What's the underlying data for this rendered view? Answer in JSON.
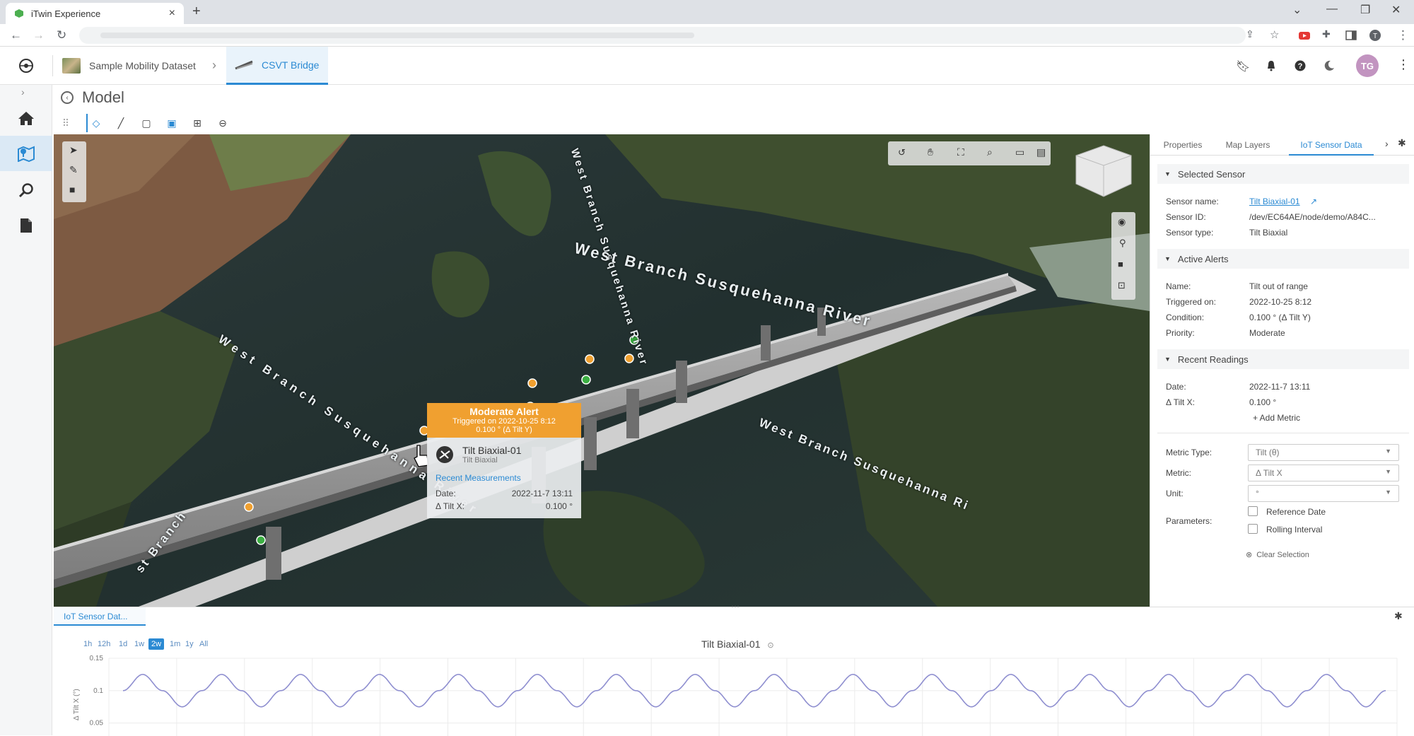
{
  "browser": {
    "tab_title": "iTwin Experience",
    "tab_close": "×",
    "new_tab": "+"
  },
  "header": {
    "breadcrumb_dataset": "Sample Mobility Dataset",
    "breadcrumb_sep": "›",
    "breadcrumb_model": "CSVT Bridge",
    "avatar_initials": "TG"
  },
  "page": {
    "title": "Model"
  },
  "map": {
    "labels": [
      "West Branch Susquehanna River",
      "West Branch Susquehanna River",
      "West Branch Susquehanna Ri",
      "West Branch Susquehanna River",
      "st Branch"
    ]
  },
  "popup": {
    "alert_title": "Moderate Alert",
    "triggered": "Triggered on 2022-10-25 8:12",
    "condition": "0.100 ° (Δ Tilt Y)",
    "sensor_name": "Tilt Biaxial-01",
    "sensor_type": "Tilt Biaxial",
    "recent_link": "Recent Measurements",
    "date_label": "Date:",
    "date_value": "2022-11-7 13:11",
    "tilt_label": "Δ Tilt X:",
    "tilt_value": "0.100 °"
  },
  "panel": {
    "tabs": [
      "Properties",
      "Map Layers",
      "IoT Sensor Data"
    ],
    "selected_sensor": {
      "title": "Selected Sensor",
      "name_label": "Sensor name:",
      "name_value": "Tilt Biaxial-01",
      "id_label": "Sensor ID:",
      "id_value": "/dev/EC64AE/node/demo/A84C...",
      "type_label": "Sensor type:",
      "type_value": "Tilt Biaxial"
    },
    "active_alerts": {
      "title": "Active Alerts",
      "name_label": "Name:",
      "name_value": "Tilt out of range",
      "triggered_label": "Triggered on:",
      "triggered_value": "2022-10-25 8:12",
      "condition_label": "Condition:",
      "condition_value": "0.100 ° (Δ Tilt Y)",
      "priority_label": "Priority:",
      "priority_value": "Moderate"
    },
    "recent_readings": {
      "title": "Recent Readings",
      "date_label": "Date:",
      "date_value": "2022-11-7 13:11",
      "tilt_label": "Δ Tilt X:",
      "tilt_value": "0.100 °",
      "add_metric": "+ Add Metric"
    },
    "settings": {
      "metric_type_label": "Metric Type:",
      "metric_type_value": "Tilt (θ)",
      "metric_label": "Metric:",
      "metric_value": "Δ Tilt X",
      "unit_label": "Unit:",
      "unit_value": "°",
      "parameters_label": "Parameters:",
      "reference_date": "Reference Date",
      "rolling_interval": "Rolling Interval",
      "clear_selection": "Clear Selection"
    }
  },
  "bottom": {
    "tab_label": "IoT Sensor Dat...",
    "ranges": [
      "1h",
      "12h",
      "1d",
      "1w",
      "2w",
      "1m",
      "1y",
      "All"
    ],
    "active_range": "2w",
    "chart_title": "Tilt Biaxial-01"
  },
  "chart_data": {
    "type": "line",
    "title": "Tilt Biaxial-01",
    "xlabel": "",
    "ylabel": "Δ Tilt X (°)",
    "ylim": [
      0.03,
      0.15
    ],
    "yticks": [
      0.15,
      0.1,
      0.05
    ],
    "ytick_labels": [
      "0.15",
      "0.1",
      "0.05"
    ],
    "grid": true,
    "series": [
      {
        "color": "#8f8fd0",
        "cycles": 16,
        "values": [
          0.1,
          0.125,
          0.1,
          0.075,
          0.1,
          0.125,
          0.1,
          0.075,
          0.1,
          0.125,
          0.1,
          0.075,
          0.1,
          0.125,
          0.1,
          0.075,
          0.1,
          0.125,
          0.1,
          0.075,
          0.1,
          0.125,
          0.1,
          0.075,
          0.1,
          0.125,
          0.1,
          0.075,
          0.1,
          0.125,
          0.1,
          0.075,
          0.1,
          0.125,
          0.1,
          0.075,
          0.1,
          0.125,
          0.1,
          0.075,
          0.1,
          0.125,
          0.1,
          0.075,
          0.1,
          0.125,
          0.1,
          0.075,
          0.1,
          0.125,
          0.1,
          0.075,
          0.1,
          0.125,
          0.1,
          0.075,
          0.1,
          0.125,
          0.1,
          0.075,
          0.1,
          0.125,
          0.1,
          0.075,
          0.1
        ]
      }
    ]
  },
  "colors": {
    "accent": "#2b8ad3",
    "alert": "#f0a030",
    "sensor_ok": "#3cb043",
    "sensor_warn": "#f0a030"
  }
}
